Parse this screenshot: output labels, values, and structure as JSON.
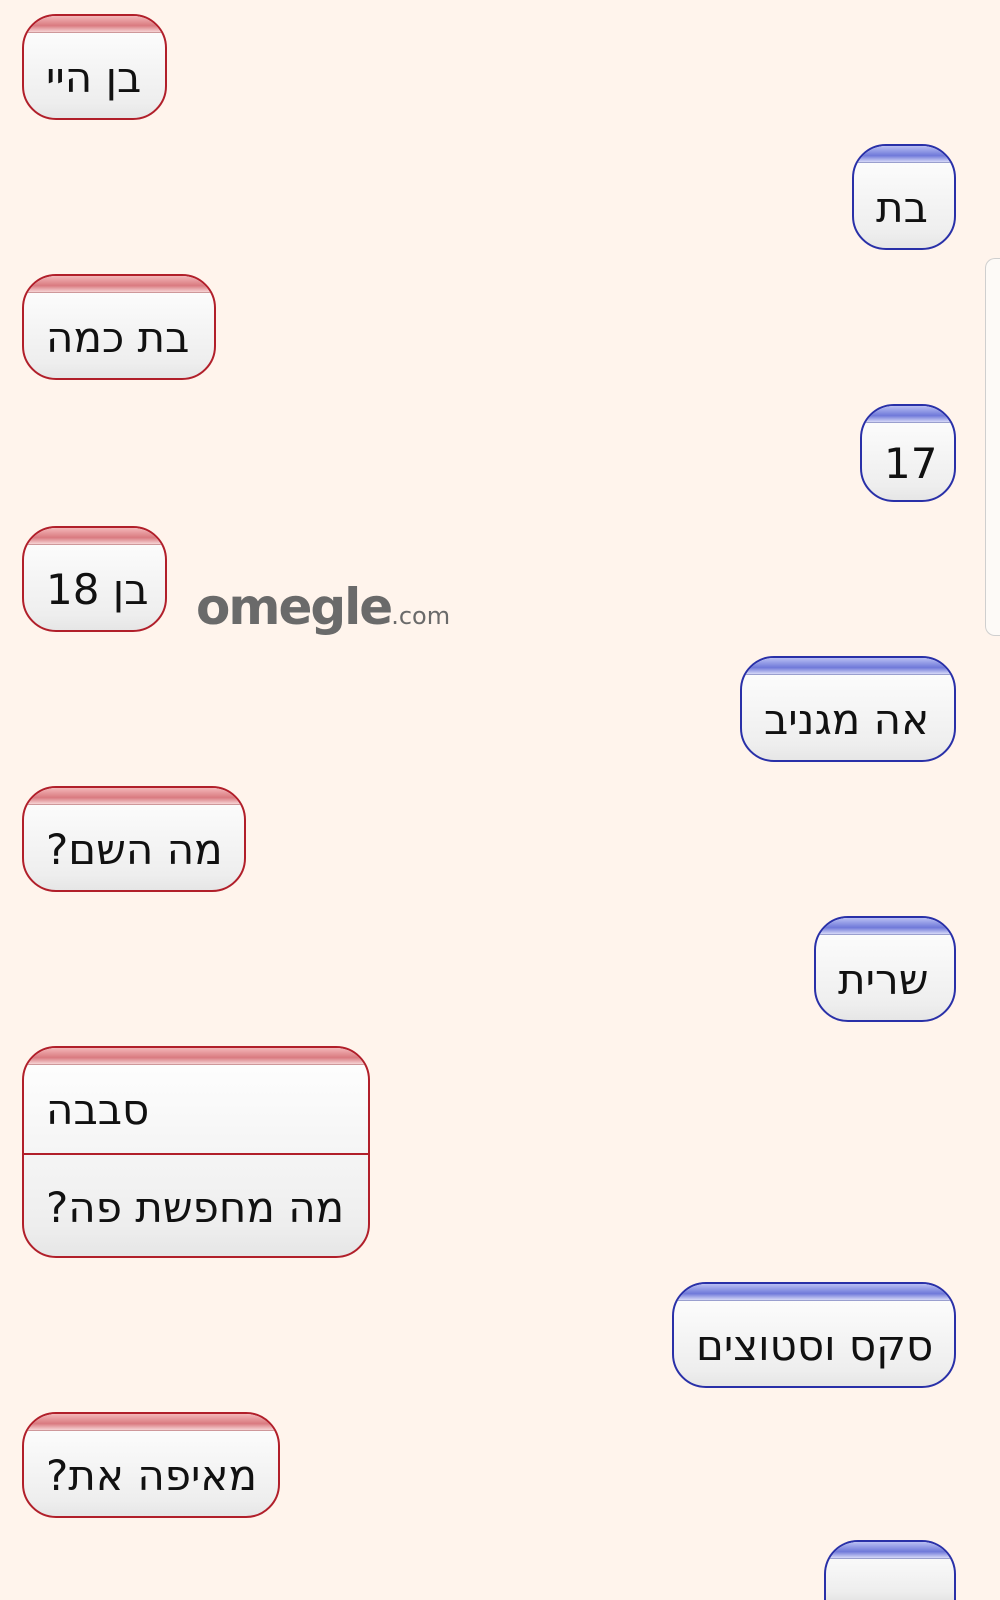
{
  "messages": [
    {
      "sender": "stranger",
      "lines": [
        "בן היי"
      ]
    },
    {
      "sender": "you",
      "lines": [
        "בת"
      ]
    },
    {
      "sender": "stranger",
      "lines": [
        "בת כמה"
      ]
    },
    {
      "sender": "you",
      "lines": [
        "17"
      ]
    },
    {
      "sender": "stranger",
      "lines": [
        "בן 18"
      ]
    },
    {
      "sender": "you",
      "lines": [
        "אה מגניב"
      ]
    },
    {
      "sender": "stranger",
      "lines": [
        "מה השם?"
      ]
    },
    {
      "sender": "you",
      "lines": [
        "שרית"
      ]
    },
    {
      "sender": "stranger",
      "lines": [
        "סבבה",
        "מה מחפשת פה?"
      ]
    },
    {
      "sender": "you",
      "lines": [
        "סקס וסטוצים"
      ]
    },
    {
      "sender": "stranger",
      "lines": [
        "מאיפה את?"
      ]
    }
  ],
  "watermark": {
    "main": "omegle",
    "suffix": ".com"
  },
  "colors": {
    "background": "#fff4ec",
    "stranger_border": "#b11f2a",
    "you_border": "#2930a8"
  }
}
